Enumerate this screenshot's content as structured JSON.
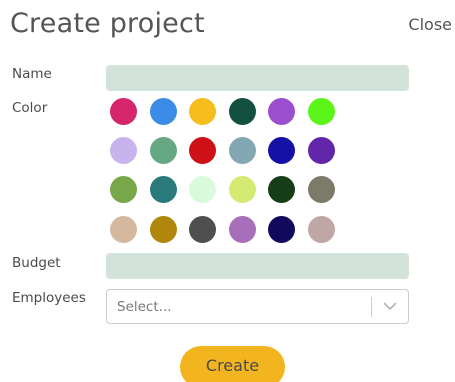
{
  "dialog": {
    "title": "Create project",
    "close_label": "Close"
  },
  "form": {
    "name_label": "Name",
    "color_label": "Color",
    "budget_label": "Budget",
    "employees_label": "Employees",
    "employees_placeholder": "Select...",
    "create_label": "Create"
  },
  "colors": [
    "#d6266b",
    "#3b8ce6",
    "#f7bd1d",
    "#145040",
    "#9b4fcf",
    "#5cf51a",
    "#c8b3ec",
    "#66a884",
    "#cd1116",
    "#83a8b4",
    "#1511a6",
    "#6127a8",
    "#77a748",
    "#2a7a7b",
    "#d9fbdc",
    "#d5ea72",
    "#153d16",
    "#7c7a68",
    "#d4b99e",
    "#b0860d",
    "#4f4f4f",
    "#a76eb9",
    "#110a5c",
    "#bfa7a5"
  ],
  "theme": {
    "accent": "#f3b51f",
    "input_bg": "#d3e3da"
  }
}
